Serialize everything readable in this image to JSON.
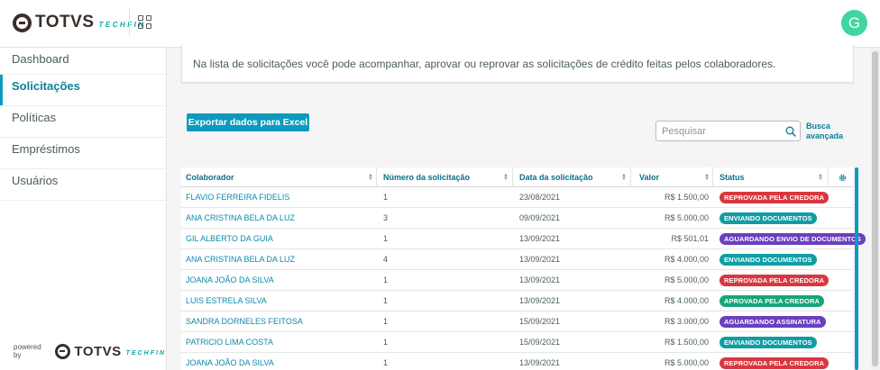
{
  "brand": {
    "name": "TOTVS",
    "sub": "TECHFIN"
  },
  "user": {
    "avatar_initial": "G"
  },
  "sidebar": {
    "items": [
      {
        "label": "Dashboard",
        "active": false
      },
      {
        "label": "Solicitações",
        "active": true
      },
      {
        "label": "Políticas",
        "active": false
      },
      {
        "label": "Empréstimos",
        "active": false
      },
      {
        "label": "Usuários",
        "active": false
      }
    ],
    "powered_by": "powered by"
  },
  "info": {
    "text": "Na lista de solicitações você pode acompanhar, aprovar ou reprovar as solicitações de crédito feitas pelos colaboradores."
  },
  "toolbar": {
    "export_label": "Exportar dados para Excel",
    "search_placeholder": "Pesquisar",
    "advanced_search_label": "Busca avançada"
  },
  "table": {
    "columns": [
      "Colaborador",
      "Número da solicitação",
      "Data da solicitação",
      "Valor",
      "Status"
    ],
    "rows": [
      {
        "colaborador": "FLAVIO FERREIRA FIDELIS",
        "numero": "1",
        "data": "23/08/2021",
        "valor": "R$ 1.500,00",
        "status": "REPROVADA PELA CREDORA",
        "status_color": "#d9373f"
      },
      {
        "colaborador": "ANA CRISTINA BELA DA LUZ",
        "numero": "3",
        "data": "09/09/2021",
        "valor": "R$ 5.000,00",
        "status": "ENVIANDO DOCUMENTOS",
        "status_color": "#0f9ea5"
      },
      {
        "colaborador": "GIL ALBERTO DA GUIA",
        "numero": "1",
        "data": "13/09/2021",
        "valor": "R$ 501,01",
        "status": "AGUARDANDO ENVIO DE DOCUMENTOS",
        "status_color": "#6b3fbf"
      },
      {
        "colaborador": "ANA CRISTINA BELA DA LUZ",
        "numero": "4",
        "data": "13/09/2021",
        "valor": "R$ 4.000,00",
        "status": "ENVIANDO DOCUMENTOS",
        "status_color": "#0f9ea5"
      },
      {
        "colaborador": "JOANA JOÃO DA SILVA",
        "numero": "1",
        "data": "13/09/2021",
        "valor": "R$ 5.000,00",
        "status": "REPROVADA PELA CREDORA",
        "status_color": "#d9373f"
      },
      {
        "colaborador": "LUIS ESTRELA SILVA",
        "numero": "1",
        "data": "13/09/2021",
        "valor": "R$ 4.000,00",
        "status": "APROVADA PELA CREDORA",
        "status_color": "#17a57a"
      },
      {
        "colaborador": "SANDRA DORNELES FEITOSA",
        "numero": "1",
        "data": "15/09/2021",
        "valor": "R$ 3.000,00",
        "status": "AGUARDANDO ASSINATURA",
        "status_color": "#6b3fbf"
      },
      {
        "colaborador": "PATRICIO LIMA COSTA",
        "numero": "1",
        "data": "15/09/2021",
        "valor": "R$ 1.500,00",
        "status": "ENVIANDO DOCUMENTOS",
        "status_color": "#0f9ea5"
      },
      {
        "colaborador": "JOANA JOÃO DA SILVA",
        "numero": "1",
        "data": "13/09/2021",
        "valor": "R$ 5.000,00",
        "status": "REPROVADA PELA CREDORA",
        "status_color": "#d9373f"
      }
    ]
  },
  "icons": {
    "apps": "apps-grid-icon",
    "search": "search-icon",
    "settings": "gear-icon",
    "sort": "sort-icon"
  }
}
